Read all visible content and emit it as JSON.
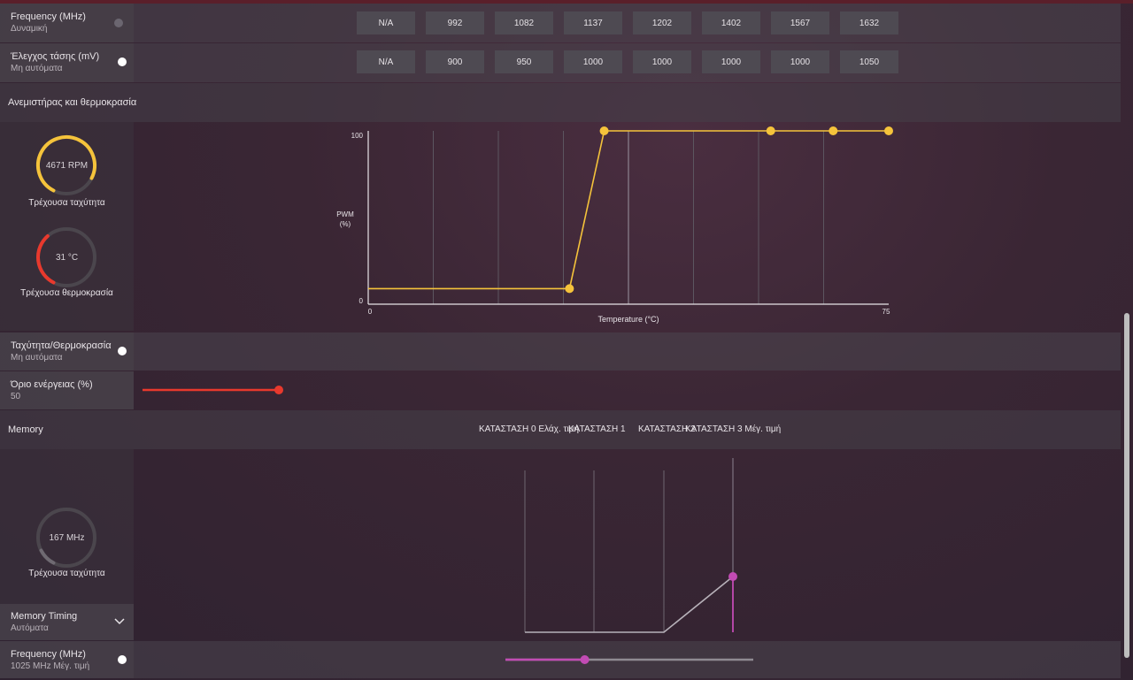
{
  "frequency_row": {
    "title": "Frequency (MHz)",
    "mode": "Δυναμική",
    "values": [
      "N/A",
      "992",
      "1082",
      "1137",
      "1202",
      "1402",
      "1567",
      "1632"
    ]
  },
  "voltage_row": {
    "title": "Έλεγχος τάσης (mV)",
    "mode": "Μη αυτόματα",
    "values": [
      "N/A",
      "900",
      "950",
      "1000",
      "1000",
      "1000",
      "1000",
      "1050"
    ]
  },
  "fan_section": {
    "header": "Ανεμιστήρας και θερμοκρασία",
    "speed_gauge": {
      "value_text": "4671 RPM",
      "caption": "Τρέχουσα ταχύτητα",
      "level": 0.75,
      "color": "#f5c33b"
    },
    "temp_gauge": {
      "value_text": "31 °C",
      "caption": "Τρέχουσα θερμοκρασία",
      "level": 0.31,
      "color": "#e8392d"
    }
  },
  "chart_data": {
    "type": "line",
    "xlabel": "Temperature (°C)",
    "ylabel": "PWM\n(%)",
    "xlim": [
      0,
      75
    ],
    "ylim": [
      0,
      100
    ],
    "x_ticks": [
      "0",
      "75"
    ],
    "y_ticks": [
      "0",
      "100"
    ],
    "color": "#f5c33b",
    "points": [
      {
        "x": 0,
        "y": 9
      },
      {
        "x": 29,
        "y": 9
      },
      {
        "x": 34,
        "y": 100
      },
      {
        "x": 58,
        "y": 100
      },
      {
        "x": 67,
        "y": 100
      },
      {
        "x": 75,
        "y": 100
      }
    ]
  },
  "speed_temp_row": {
    "title": "Ταχύτητα/Θερμοκρασία",
    "mode": "Μη αυτόματα"
  },
  "power_row": {
    "title": "Όριο ενέργειας (%)",
    "value": "50",
    "slider_level": 0.5,
    "color": "#e8392d"
  },
  "memory_section": {
    "header": "Memory",
    "states": [
      "ΚΑΤΑΣΤΑΣΗ 0 Ελάχ. τιμή",
      "ΚΑΤΑΣΤΑΣΗ 1",
      "ΚΑΤΑΣΤΑΣΗ 2",
      "ΚΑΤΑΣΤΑΣΗ 3 Μέγ. τιμή"
    ],
    "gauge": {
      "value_text": "167 MHz",
      "caption": "Τρέχουσα ταχύτητα",
      "level": 0.1
    },
    "curve_color": "#c24bb4"
  },
  "memory_timing_row": {
    "title": "Memory Timing",
    "mode": "Αυτόματα"
  },
  "memory_freq_row": {
    "title": "Frequency (MHz)",
    "mode": "1025 MHz Μέγ. τιμή",
    "slider_level": 0.32,
    "color": "#c24bb4"
  }
}
